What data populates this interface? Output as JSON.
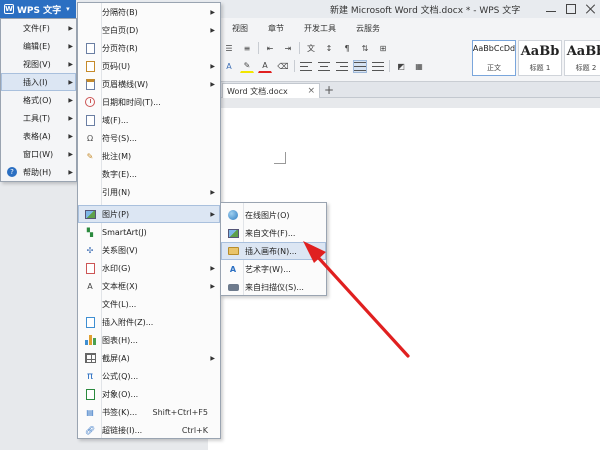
{
  "app": {
    "brand": "WPS 文字",
    "window_title": "新建 Microsoft Word 文档.docx * - WPS 文字"
  },
  "colors": {
    "brand_blue": "#2b6fc2",
    "annotation_red": "#e02020",
    "highlight": "#dce6f3"
  },
  "ribbon": {
    "tabs": [
      "视图",
      "章节",
      "开发工具",
      "云服务"
    ],
    "styles": [
      {
        "sample": "AaBbCcDd",
        "name": "正文"
      },
      {
        "sample": "AaBb",
        "name": "标题 1"
      },
      {
        "sample": "AaBb",
        "name": "标题 2"
      }
    ]
  },
  "doc_tab": {
    "label": "Word 文档.docx",
    "close": "×",
    "new_tab": "+"
  },
  "main_menu": {
    "items": [
      {
        "label": "文件(F)",
        "submenu": true
      },
      {
        "label": "编辑(E)",
        "submenu": true
      },
      {
        "label": "视图(V)",
        "submenu": true
      },
      {
        "label": "插入(I)",
        "submenu": true
      },
      {
        "label": "格式(O)",
        "submenu": true
      },
      {
        "label": "工具(T)",
        "submenu": true
      },
      {
        "label": "表格(A)",
        "submenu": true
      },
      {
        "label": "窗口(W)",
        "submenu": true
      },
      {
        "label": "帮助(H)",
        "submenu": true
      }
    ]
  },
  "insert_menu": {
    "items": [
      {
        "label": "分隔符(B)",
        "submenu": true,
        "icon": "none"
      },
      {
        "label": "空白页(D)",
        "submenu": true,
        "icon": "none"
      },
      {
        "label": "分页符(R)",
        "submenu": false,
        "icon": "page-break-icon"
      },
      {
        "label": "页码(U)",
        "submenu": true,
        "icon": "page-number-icon"
      },
      {
        "label": "页眉横线(W)",
        "submenu": true,
        "icon": "header-line-icon"
      },
      {
        "label": "日期和时间(T)...",
        "submenu": false,
        "icon": "date-time-icon"
      },
      {
        "label": "域(F)...",
        "submenu": false,
        "icon": "field-icon"
      },
      {
        "label": "符号(S)...",
        "submenu": false,
        "icon": "symbol-icon"
      },
      {
        "label": "批注(M)",
        "submenu": false,
        "icon": "comment-icon"
      },
      {
        "label": "数字(E)...",
        "submenu": false,
        "icon": "none"
      },
      {
        "label": "引用(N)",
        "submenu": true,
        "icon": "none"
      },
      {
        "label": "图片(P)",
        "submenu": true,
        "icon": "picture-icon"
      },
      {
        "label": "SmartArt(J)",
        "submenu": false,
        "icon": "smartart-icon"
      },
      {
        "label": "关系图(V)",
        "submenu": false,
        "icon": "diagram-icon"
      },
      {
        "label": "水印(G)",
        "submenu": true,
        "icon": "watermark-icon"
      },
      {
        "label": "文本框(X)",
        "submenu": true,
        "icon": "textbox-icon"
      },
      {
        "label": "文件(L)...",
        "submenu": false,
        "icon": "none"
      },
      {
        "label": "插入附件(Z)...",
        "submenu": false,
        "icon": "attachment-icon"
      },
      {
        "label": "图表(H)...",
        "submenu": false,
        "icon": "chart-icon"
      },
      {
        "label": "截屏(A)",
        "submenu": true,
        "icon": "screenshot-icon"
      },
      {
        "label": "公式(Q)...",
        "submenu": false,
        "icon": "formula-icon"
      },
      {
        "label": "对象(O)...",
        "submenu": false,
        "icon": "object-icon"
      },
      {
        "label": "书签(K)...",
        "submenu": false,
        "icon": "bookmark-icon",
        "shortcut": "Shift+Ctrl+F5"
      },
      {
        "label": "超链接(I)...",
        "submenu": false,
        "icon": "hyperlink-icon",
        "shortcut": "Ctrl+K"
      }
    ]
  },
  "picture_menu": {
    "items": [
      {
        "label": "在线图片(O)",
        "icon": "online-picture-icon"
      },
      {
        "label": "来自文件(F)...",
        "icon": "from-file-icon"
      },
      {
        "label": "插入画布(N)...",
        "icon": "insert-canvas-icon"
      },
      {
        "label": "艺术字(W)...",
        "icon": "wordart-icon"
      },
      {
        "label": "来自扫描仪(S)...",
        "icon": "scanner-icon"
      }
    ]
  }
}
